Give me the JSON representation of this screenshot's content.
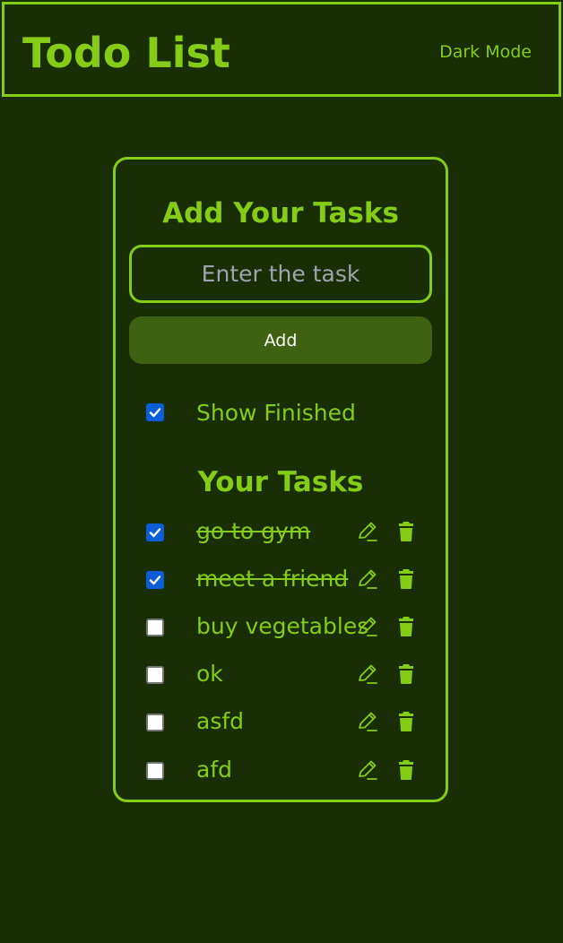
{
  "header": {
    "title": "Todo List",
    "dark_mode_label": "Dark Mode"
  },
  "add_section": {
    "heading": "Add Your Tasks",
    "input_placeholder": "Enter the task",
    "input_value": "",
    "add_button_label": "Add"
  },
  "show_finished": {
    "label": "Show Finished",
    "checked": true
  },
  "tasks_section": {
    "heading": "Your Tasks",
    "tasks": [
      {
        "text": "go to gym",
        "done": true
      },
      {
        "text": "meet a friend",
        "done": true
      },
      {
        "text": "buy vegetables",
        "done": false
      },
      {
        "text": "ok",
        "done": false
      },
      {
        "text": "asfd",
        "done": false
      },
      {
        "text": "afd",
        "done": false
      }
    ],
    "edit_icon": "pencil-icon",
    "delete_icon": "trash-icon"
  },
  "colors": {
    "background": "#1a2e05",
    "accent": "#84cc16",
    "button": "#3f6212",
    "checkbox_checked": "#0b5ed7"
  }
}
